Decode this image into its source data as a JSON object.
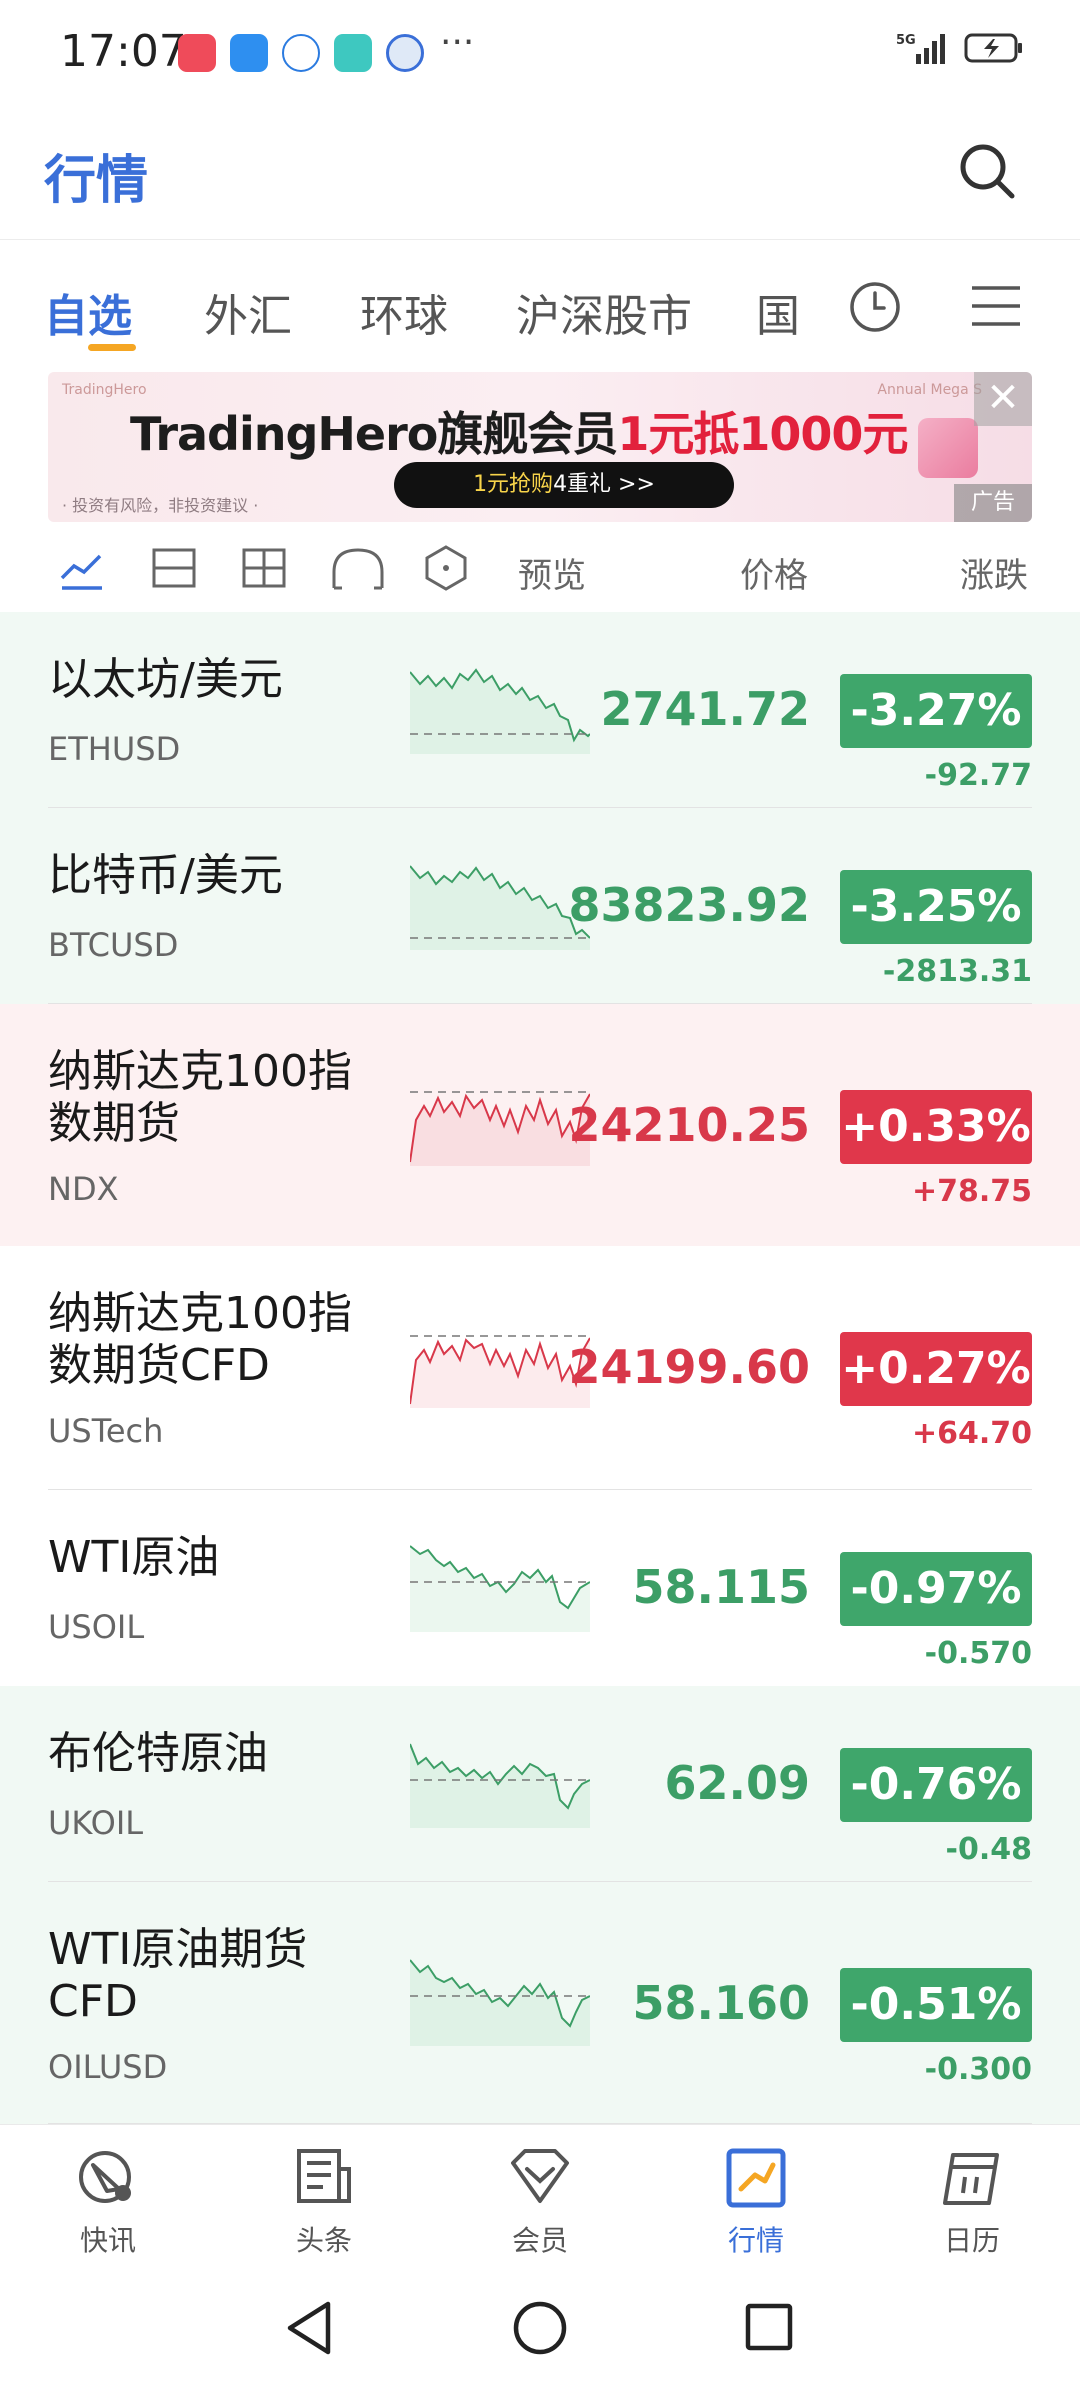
{
  "status": {
    "time": "17:07",
    "more": "···",
    "network": "5G"
  },
  "header": {
    "title": "行情"
  },
  "tabs": [
    "自选",
    "外汇",
    "环球",
    "沪深股市",
    "国"
  ],
  "banner": {
    "brand_small": "TradingHero",
    "annual": "Annual Mega S",
    "headline_prefix": "TradingHero旗舰会员",
    "headline_highlight": "1元抵1000元",
    "cta_highlight": "1元抢购",
    "cta_rest": "4重礼 >>",
    "risk": "· 投资有风险，非投资建议 ·",
    "ad_label": "广告",
    "close": "✕"
  },
  "toolbar": {
    "preview": "预览",
    "price": "价格",
    "change": "涨跌"
  },
  "rows": [
    {
      "name": "以太坊/美元",
      "code": "ETHUSD",
      "price": "2741.72",
      "pct": "-3.27%",
      "chg": "-92.77",
      "trend": "down"
    },
    {
      "name": "比特币/美元",
      "code": "BTCUSD",
      "price": "83823.92",
      "pct": "-3.25%",
      "chg": "-2813.31",
      "trend": "down"
    },
    {
      "name": "纳斯达克100指数期货",
      "code": "NDX",
      "price": "24210.25",
      "pct": "+0.33%",
      "chg": "+78.75",
      "trend": "up"
    },
    {
      "name": "纳斯达克100指数期货CFD",
      "code": "USTech",
      "price": "24199.60",
      "pct": "+0.27%",
      "chg": "+64.70",
      "trend": "up"
    },
    {
      "name": "WTI原油",
      "code": "USOIL",
      "price": "58.115",
      "pct": "-0.97%",
      "chg": "-0.570",
      "trend": "down"
    },
    {
      "name": "布伦特原油",
      "code": "UKOIL",
      "price": "62.09",
      "pct": "-0.76%",
      "chg": "-0.48",
      "trend": "down"
    },
    {
      "name": "WTI原油期货CFD",
      "code": "OILUSD",
      "price": "58.160",
      "pct": "-0.51%",
      "chg": "-0.300",
      "trend": "down"
    }
  ],
  "nav": [
    {
      "label": "快讯",
      "icon": "flash-news-icon"
    },
    {
      "label": "头条",
      "icon": "headlines-icon"
    },
    {
      "label": "会员",
      "icon": "membership-icon"
    },
    {
      "label": "行情",
      "icon": "market-icon"
    },
    {
      "label": "日历",
      "icon": "calendar-icon"
    }
  ],
  "colors": {
    "accent": "#3a6fd8",
    "up": "#e0374b",
    "down": "#3fa66b",
    "tab_underline": "#f5a623"
  }
}
